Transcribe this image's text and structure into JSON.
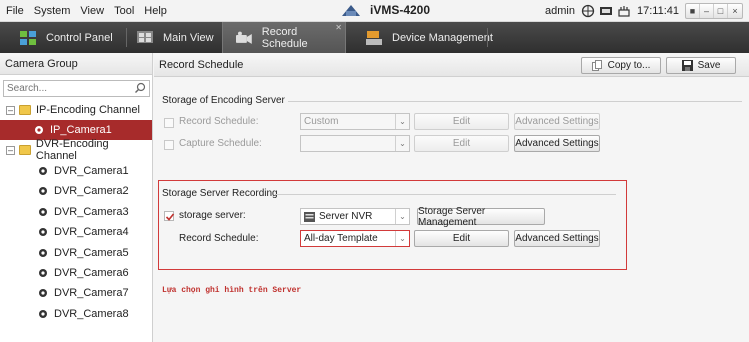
{
  "menu": [
    "File",
    "System",
    "View",
    "Tool",
    "Help"
  ],
  "app_title": "iVMS-4200",
  "user": "admin",
  "clock": "17:11:41",
  "tabs": {
    "control_panel": "Control Panel",
    "main_view": "Main View",
    "record_schedule": "Record Schedule",
    "device_management": "Device Management"
  },
  "left": {
    "header": "Camera Group",
    "search_placeholder": "Search...",
    "groups": [
      {
        "label": "IP-Encoding Channel",
        "cameras": [
          "IP_Camera1"
        ]
      },
      {
        "label": "DVR-Encoding Channel",
        "cameras": [
          "DVR_Camera1",
          "DVR_Camera2",
          "DVR_Camera3",
          "DVR_Camera4",
          "DVR_Camera5",
          "DVR_Camera6",
          "DVR_Camera7",
          "DVR_Camera8"
        ]
      }
    ]
  },
  "main": {
    "title": "Record Schedule",
    "copy_button": "Copy to...",
    "save_button": "Save",
    "encoding_server": {
      "title": "Storage of Encoding Server",
      "record_schedule_label": "Record Schedule:",
      "record_schedule_value": "Custom",
      "capture_schedule_label": "Capture Schedule:",
      "capture_schedule_value": "",
      "edit_label": "Edit",
      "advanced_label": "Advanced Settings"
    },
    "server_recording": {
      "title": "Storage Server Recording",
      "storage_server_label": "storage server:",
      "storage_server_checked": true,
      "storage_server_value": "Server NVR",
      "management_button": "Storage Server Management",
      "record_schedule_label": "Record Schedule:",
      "record_schedule_value": "All-day Template",
      "edit_label": "Edit",
      "advanced_label": "Advanced Settings"
    },
    "note": "Lựa chọn ghi hình trên Server"
  },
  "colors": {
    "accent_red": "#d23a3a",
    "selected_row": "#a72b2b",
    "tabbar": "#3a3a3a"
  }
}
